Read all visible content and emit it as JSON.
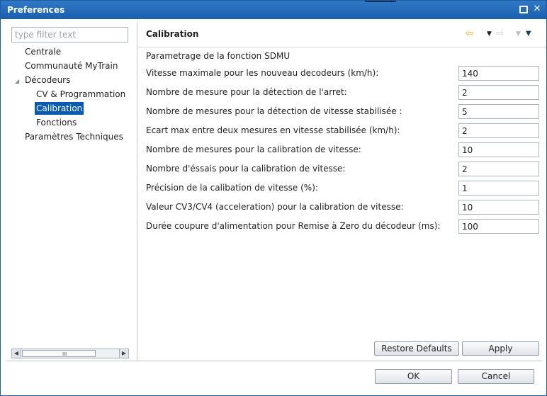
{
  "window": {
    "title": "Preferences"
  },
  "filter": {
    "placeholder": "type filter text"
  },
  "tree": {
    "items": [
      {
        "label": "Centrale"
      },
      {
        "label": "Communauté MyTrain"
      },
      {
        "label": "Décodeurs",
        "expanded": true
      },
      {
        "label": "CV & Programmation"
      },
      {
        "label": "Calibration",
        "selected": true
      },
      {
        "label": "Fonctions"
      },
      {
        "label": "Paramètres Techniques"
      }
    ],
    "scrollbar_grip": "III"
  },
  "page": {
    "title": "Calibration",
    "section_title": "Parametrage de la fonction SDMU",
    "fields": [
      {
        "label": "Vitesse maximale pour les nouveau decodeurs (km/h):",
        "value": "140"
      },
      {
        "label": "Nombre de mesure pour la détection de l'arret:",
        "value": "2"
      },
      {
        "label": "Nombre de mesures pour la détection de vitesse stabilisée :",
        "value": "5"
      },
      {
        "label": "Ecart max entre deux mesures en vitesse stabilisée (km/h):",
        "value": "2"
      },
      {
        "label": "Nombre de mesures pour la calibration de vitesse:",
        "value": "10"
      },
      {
        "label": "Nombre d'éssais pour la calibration de vitesse:",
        "value": "2"
      },
      {
        "label": "Précision de la calibation de vitesse (%):",
        "value": "1"
      },
      {
        "label": "Valeur CV3/CV4 (acceleration) pour la calibration de vitesse:",
        "value": "10"
      },
      {
        "label": "Durée coupure d'alimentation pour Remise à Zero du décodeur (ms):",
        "value": "100"
      }
    ]
  },
  "buttons": {
    "restore_defaults": "Restore Defaults",
    "apply": "Apply",
    "ok": "OK",
    "cancel": "Cancel"
  },
  "colors": {
    "titlebar": "#1b5fae",
    "selection": "#0a5bb0"
  },
  "icons": [
    "maximize-icon",
    "close-icon",
    "back-arrow-icon",
    "forward-arrow-icon",
    "view-menu-icon"
  ]
}
